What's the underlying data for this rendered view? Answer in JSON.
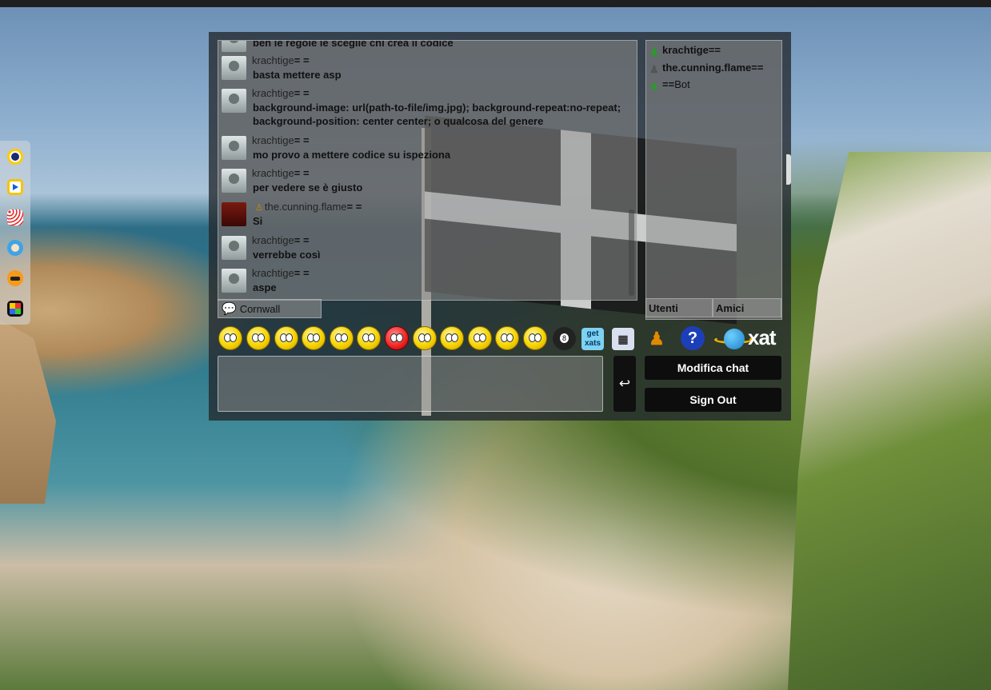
{
  "colors": {
    "chat_background": "#23282d",
    "button_background": "#0d0d0d",
    "button_text": "#ffffff"
  },
  "dock": {
    "apps": [
      {
        "icon": "pokeball-icon"
      },
      {
        "icon": "play-icon"
      },
      {
        "icon": "grid-dots-icon"
      },
      {
        "icon": "blue-avatar-icon"
      },
      {
        "icon": "orange-face-icon"
      },
      {
        "icon": "color-blocks-icon"
      }
    ]
  },
  "messages": [
    {
      "user": "",
      "text": "ben le regole le sceglie chi crea il codice"
    },
    {
      "user": "krachtige",
      "eq": "= =",
      "text": "basta mettere asp"
    },
    {
      "user": "krachtige",
      "eq": "= =",
      "text": "background-image: url(path-to-file/img.jpg); background-repeat:no-repeat; background-position: center center; o qualcosa del genere"
    },
    {
      "user": "krachtige",
      "eq": "= =",
      "text": "mo provo a mettere codice su ispeziona"
    },
    {
      "user": "krachtige",
      "eq": "= =",
      "text": "per vedere se è giusto"
    },
    {
      "user": "the.cunning.flame",
      "eq": "= =",
      "text": "Si"
    },
    {
      "user": "krachtige",
      "eq": "= =",
      "text": "verrebbe così"
    },
    {
      "user": "krachtige",
      "eq": "= =",
      "text": "aspe"
    }
  ],
  "room_tab": {
    "label": "Cornwall"
  },
  "users": [
    {
      "name": "krachtige",
      "suffix": "==",
      "icon": "green-user-icon"
    },
    {
      "name": "the.cunning.flame",
      "suffix": "==",
      "icon": "gray-user-icon"
    },
    {
      "prefix": "==",
      "name": "Bot",
      "icon": "bot-user-icon"
    }
  ],
  "user_tabs": {
    "users": "Utenti",
    "friends": "Amici"
  },
  "toolbar": {
    "get_xats": "get xats",
    "help": "?",
    "logo": "xat"
  },
  "input": {
    "value": "",
    "send_symbol": "↩"
  },
  "buttons": {
    "edit_chat": "Modifica chat",
    "sign_out": "Sign Out"
  }
}
